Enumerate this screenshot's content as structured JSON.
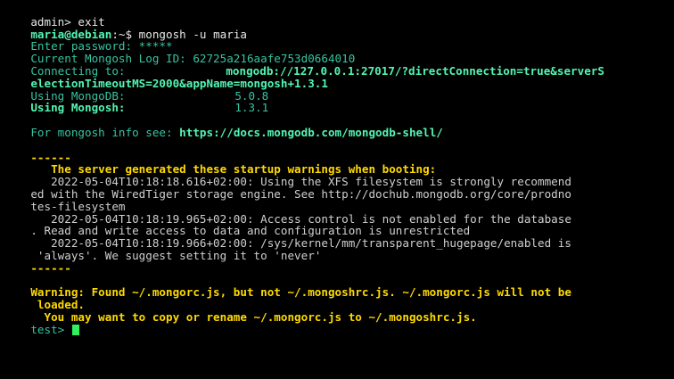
{
  "terminal": {
    "lines": [
      [
        "admin> exit"
      ],
      [
        "maria@debian",
        ":~$ mongosh -u maria"
      ],
      [
        "Enter password: *****"
      ],
      [
        "Current Mongosh Log ID: 62725a216aafe753d0664010"
      ],
      [
        "Connecting to:",
        "mongodb://127.0.0.1:27017/?directConnection=true&serverS"
      ],
      [
        "electionTimeoutMS=2000&appName=mongosh+1.3.1"
      ],
      [
        "Using MongoDB:",
        "5.0.8"
      ],
      [
        "Using Mongosh:",
        "1.3.1"
      ],
      [
        ""
      ],
      [
        "For mongosh info see: ",
        "https://docs.mongodb.com/mongodb-shell/"
      ],
      [
        ""
      ],
      [
        "------"
      ],
      [
        "   The server generated these startup warnings when booting:"
      ],
      [
        "   2022-05-04T10:18:18.616+02:00: Using the XFS filesystem is strongly recommend"
      ],
      [
        "ed with the WiredTiger storage engine. See http://dochub.mongodb.org/core/prodno"
      ],
      [
        "tes-filesystem"
      ],
      [
        "   2022-05-04T10:18:19.965+02:00: Access control is not enabled for the database"
      ],
      [
        ". Read and write access to data and configuration is unrestricted"
      ],
      [
        "   2022-05-04T10:18:19.966+02:00: /sys/kernel/mm/transparent_hugepage/enabled is"
      ],
      [
        " 'always'. We suggest setting it to 'never'"
      ],
      [
        "------"
      ],
      [
        ""
      ],
      [
        "Warning: Found ~/.mongorc.js, but not ~/.mongoshrc.js. ~/.mongorc.js will not be"
      ],
      [
        " loaded."
      ],
      [
        "  You may want to copy or rename ~/.mongorc.js to ~/.mongoshrc.js."
      ],
      [
        "test> "
      ]
    ]
  },
  "colors": {
    "background": "#000000",
    "output": "#cfcfcf",
    "prompt_user": "#52f5b3",
    "info_teal": "#37c3a0",
    "warning_yellow": "#ffd900",
    "cursor": "#2ff05f"
  }
}
